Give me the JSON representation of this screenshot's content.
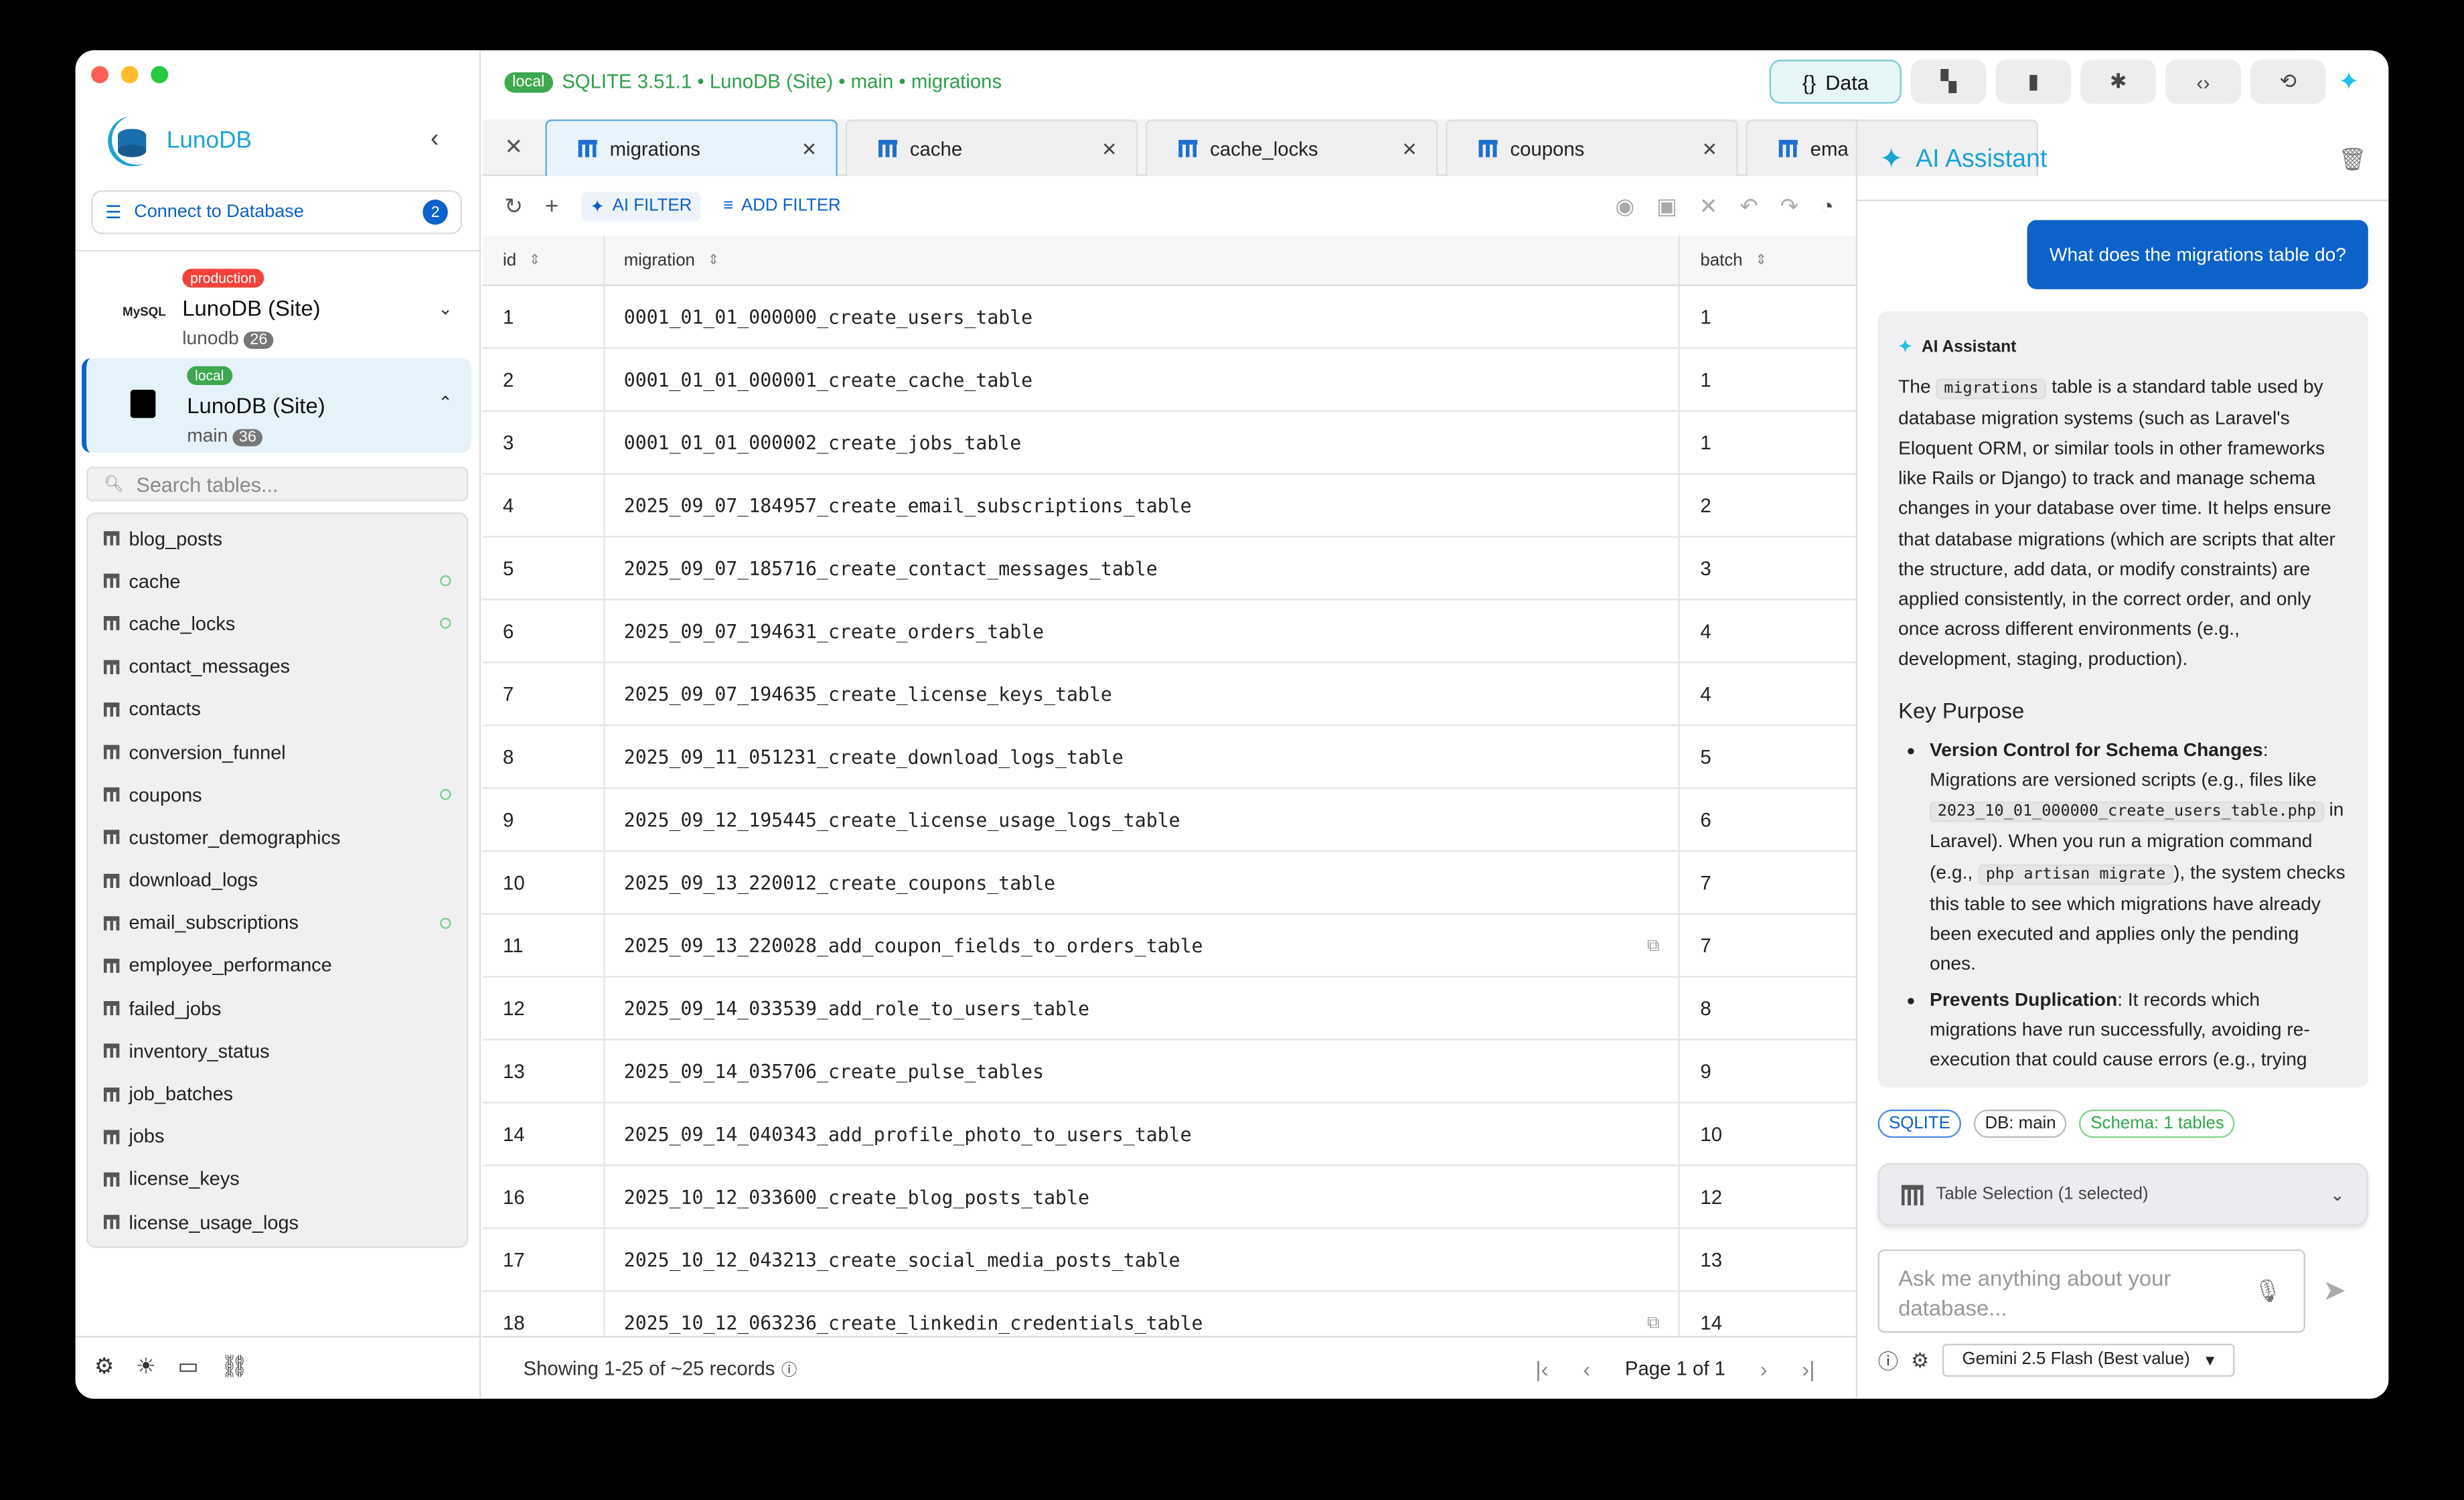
{
  "app": {
    "name": "LunoDB"
  },
  "sidebar": {
    "connect_label": "Connect to Database",
    "connect_count": "2",
    "connections": [
      {
        "tag": "production",
        "name": "LunoDB (Site)",
        "db": "lunodb",
        "count": "26",
        "engine": "MySQL"
      },
      {
        "tag": "local",
        "name": "LunoDB (Site)",
        "db": "main",
        "count": "36",
        "engine": "SQLite"
      }
    ],
    "search_placeholder": "Search tables...",
    "tables": [
      {
        "name": "blog_posts",
        "open": false
      },
      {
        "name": "cache",
        "open": true
      },
      {
        "name": "cache_locks",
        "open": true
      },
      {
        "name": "contact_messages",
        "open": false
      },
      {
        "name": "contacts",
        "open": false
      },
      {
        "name": "conversion_funnel",
        "open": false
      },
      {
        "name": "coupons",
        "open": true
      },
      {
        "name": "customer_demographics",
        "open": false
      },
      {
        "name": "download_logs",
        "open": false
      },
      {
        "name": "email_subscriptions",
        "open": true
      },
      {
        "name": "employee_performance",
        "open": false
      },
      {
        "name": "failed_jobs",
        "open": false
      },
      {
        "name": "inventory_status",
        "open": false
      },
      {
        "name": "job_batches",
        "open": false
      },
      {
        "name": "jobs",
        "open": false
      },
      {
        "name": "license_keys",
        "open": false
      },
      {
        "name": "license_usage_logs",
        "open": false
      }
    ]
  },
  "header": {
    "env": "local",
    "breadcrumb": "SQLITE 3.51.1 • LunoDB (Site) • main • migrations",
    "data_label": "Data"
  },
  "tabs": [
    "migrations",
    "cache",
    "cache_locks",
    "coupons",
    "ema"
  ],
  "toolbar": {
    "ai_filter": "AI FILTER",
    "add_filter": "ADD FILTER"
  },
  "grid": {
    "columns": [
      "id",
      "migration",
      "batch"
    ],
    "rows": [
      [
        "1",
        "0001_01_01_000000_create_users_table",
        "1"
      ],
      [
        "2",
        "0001_01_01_000001_create_cache_table",
        "1"
      ],
      [
        "3",
        "0001_01_01_000002_create_jobs_table",
        "1"
      ],
      [
        "4",
        "2025_09_07_184957_create_email_subscriptions_table",
        "2"
      ],
      [
        "5",
        "2025_09_07_185716_create_contact_messages_table",
        "3"
      ],
      [
        "6",
        "2025_09_07_194631_create_orders_table",
        "4"
      ],
      [
        "7",
        "2025_09_07_194635_create_license_keys_table",
        "4"
      ],
      [
        "8",
        "2025_09_11_051231_create_download_logs_table",
        "5"
      ],
      [
        "9",
        "2025_09_12_195445_create_license_usage_logs_table",
        "6"
      ],
      [
        "10",
        "2025_09_13_220012_create_coupons_table",
        "7"
      ],
      [
        "11",
        "2025_09_13_220028_add_coupon_fields_to_orders_table",
        "7"
      ],
      [
        "12",
        "2025_09_14_033539_add_role_to_users_table",
        "8"
      ],
      [
        "13",
        "2025_09_14_035706_create_pulse_tables",
        "9"
      ],
      [
        "14",
        "2025_09_14_040343_add_profile_photo_to_users_table",
        "10"
      ],
      [
        "16",
        "2025_10_12_033600_create_blog_posts_table",
        "12"
      ],
      [
        "17",
        "2025_10_12_043213_create_social_media_posts_table",
        "13"
      ],
      [
        "18",
        "2025_10_12_063236_create_linkedin_credentials_table",
        "14"
      ]
    ],
    "footer": "Showing 1-25 of ~25 records",
    "page": "Page 1 of 1"
  },
  "assistant": {
    "title": "AI Assistant",
    "user_message": "What does the migrations table do?",
    "reply_label": "AI Assistant",
    "p1_a": "The ",
    "p1_code": "migrations",
    "p1_b": " table is a standard table used by database migration systems (such as Laravel's Eloquent ORM, or similar tools in other frameworks like Rails or Django) to track and manage schema changes in your database over time. It helps ensure that database migrations (which are scripts that alter the structure, add data, or modify constraints) are applied consistently, in the correct order, and only once across different environments (e.g., development, staging, production).",
    "h_key": "Key Purpose",
    "b1_title": "Version Control for Schema Changes",
    "b1_a": ": Migrations are versioned scripts (e.g., files like ",
    "b1_code1": "2023_10_01_000000_create_users_table.php",
    "b1_b": " in Laravel). When you run a migration command (e.g., ",
    "b1_code2": "php artisan migrate",
    "b1_c": "), the system checks this table to see which migrations have already been executed and applies only the pending ones.",
    "b2_title": "Prevents Duplication",
    "b2_a": ": It records which migrations have run successfully, avoiding re-execution that could cause errors (e.g., trying",
    "chips": [
      "SQLITE",
      "DB: main",
      "Schema: 1 tables"
    ],
    "table_selection": "Table Selection (1 selected)",
    "input_placeholder": "Ask me anything about your database...",
    "model": "Gemini 2.5 Flash (Best value)"
  }
}
